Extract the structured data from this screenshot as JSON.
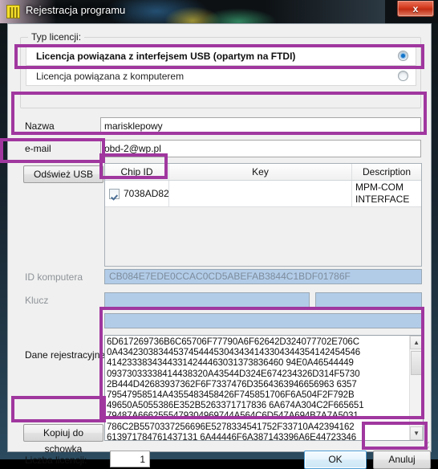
{
  "window": {
    "title": "Rejestracja programu",
    "icon": "book-icon",
    "close_label": "x",
    "accent_highlight": "#a0379f"
  },
  "license_type": {
    "group_title": "Typ licencji:",
    "options": [
      {
        "label": "Licencja powiązana z interfejsem USB (opartym na FTDI)",
        "selected": true
      },
      {
        "label": "Licencja powiązana z komputerem",
        "selected": false
      }
    ]
  },
  "form": {
    "name_label": "Nazwa",
    "name_value": "marisklepowy",
    "name_placeholder": "",
    "email_label": "e-mail",
    "email_value": "obd-2@wp.pl",
    "email_placeholder": ""
  },
  "usb": {
    "refresh_label": "Odśwież USB"
  },
  "chip_table": {
    "columns": [
      "Chip ID",
      "Key",
      "Description"
    ],
    "rows": [
      {
        "checked": true,
        "chip_id": "7038AD82",
        "key": "",
        "description_line1": "MPM-COM",
        "description_line2": "INTERFACE"
      }
    ]
  },
  "computer": {
    "id_label": "ID komputera",
    "id_value": "CB084E7EDE0CCAC0CD5ABEFAB3844C1BDF01786F",
    "key_label": "Klucz",
    "key_value_1": "",
    "key_value_2": "",
    "key_value_3": ""
  },
  "registration": {
    "label": "Dane rejestracyjne",
    "copy_label": "Kopiuj do schowka",
    "data": "6D617269736B6C65706F77790A6F62642D324077702E706C\n0A434230383445374544453043434143304344354142454546\n41423338343443314244463031373836460 94E0A46544449\n09373033338414438320A43544D324E674234326D314F5730\n2B444D42683937362F6F7337476D3564363946656963 6357\n79547958514A4355483458426F745851706F6A504F2F792B\n49650A5055386E352B5263371717836 6A674A304C2F665651\n79487A6662555479304969744A564C6D547A694B7A7A5031\n786C2B5570337256696E5278334541752F33710A42394162\n613971784761437131 6A44446F6A387143396A6E44723346",
    "scrollbar": {
      "up": "▲",
      "down": "▼"
    }
  },
  "footer": {
    "count_label": "Liczba licencji:",
    "count_value": "1",
    "ok_label": "OK",
    "cancel_label": "Anuluj"
  }
}
